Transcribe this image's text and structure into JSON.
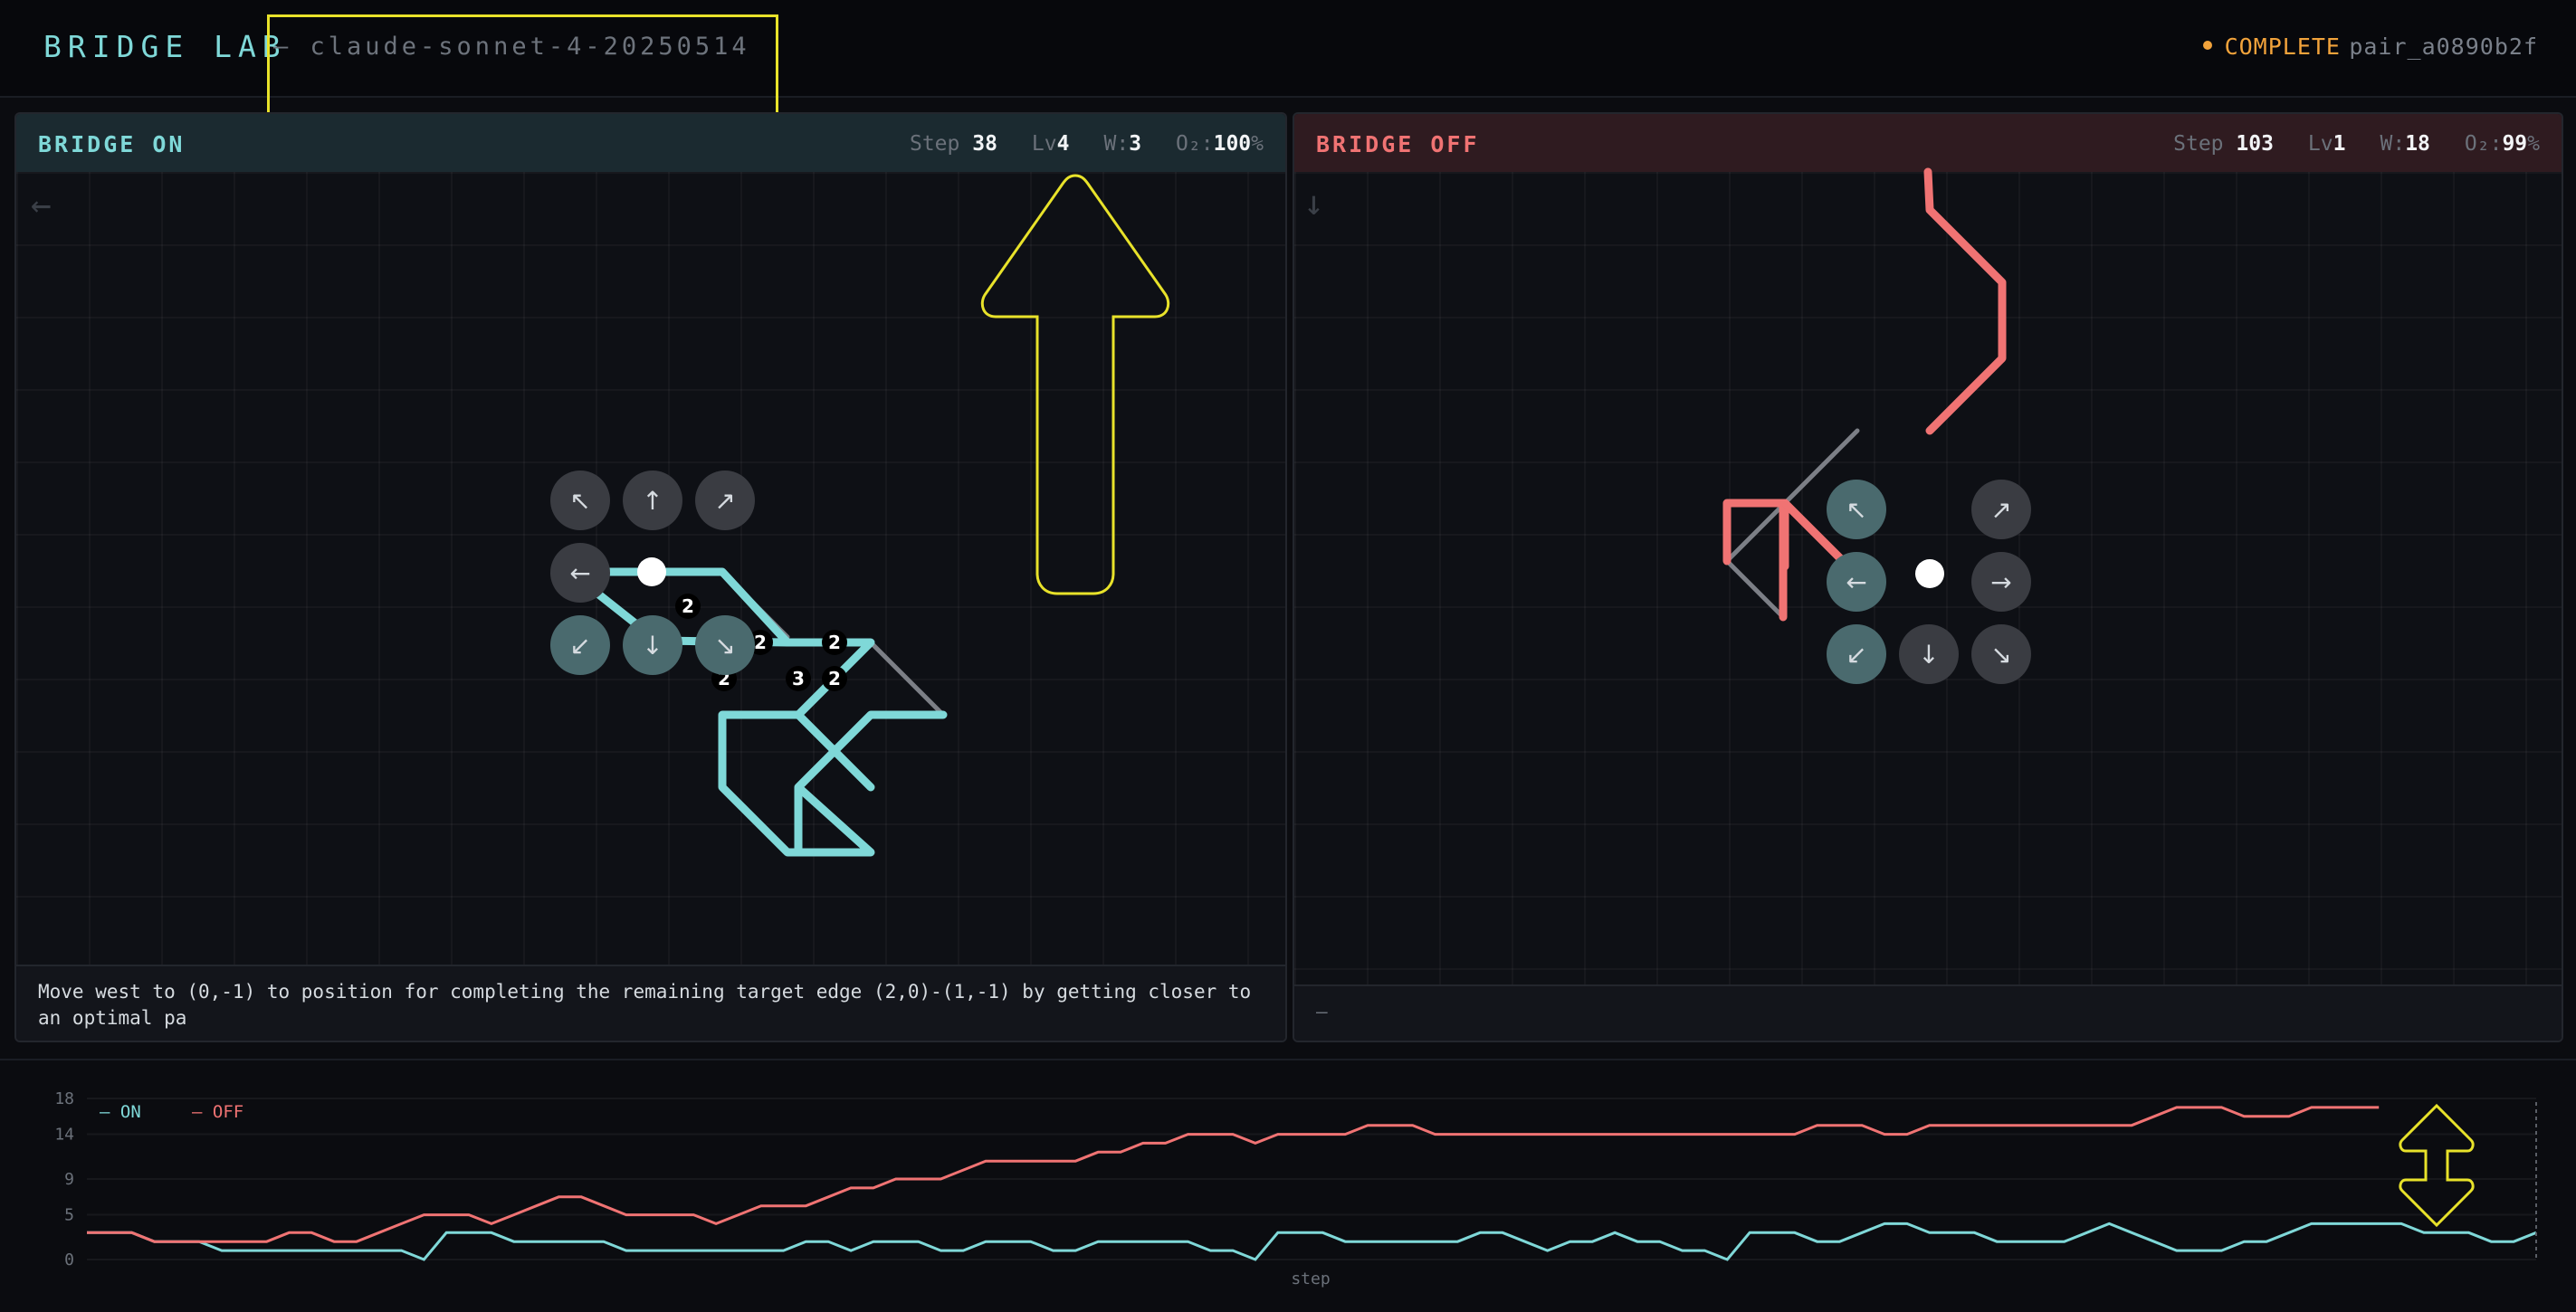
{
  "header": {
    "brand": "BRIDGE LAB",
    "model": "— claude-sonnet-4-20250514",
    "status": "COMPLETE",
    "pair_id": "pair_a0890b2f"
  },
  "panels": {
    "on": {
      "title": "BRIDGE ON",
      "step_label": "Step",
      "step": "38",
      "lv_label": "Lv",
      "lv": "4",
      "w_label": "W:",
      "w": "3",
      "o2_label": "O₂:",
      "o2": "100",
      "o2_unit": "%",
      "prev_move_icon": "←",
      "moves": [
        "↖",
        "↑",
        "↗",
        "←",
        "↙",
        "↓",
        "↘"
      ],
      "edge_labels": [
        "2",
        "2",
        "2",
        "2",
        "3",
        "2"
      ],
      "caption": "Move west to (0,-1) to position for completing the remaining target edge (2,0)-(1,-1) by getting closer to an optimal pa"
    },
    "off": {
      "title": "BRIDGE OFF",
      "step_label": "Step",
      "step": "103",
      "lv_label": "Lv",
      "lv": "1",
      "w_label": "W:",
      "w": "18",
      "o2_label": "O₂:",
      "o2": "99",
      "o2_unit": "%",
      "prev_move_icon": "↓",
      "moves": [
        "↖",
        "↗",
        "←",
        "→",
        "↙",
        "↓",
        "↘"
      ],
      "caption": "—"
    }
  },
  "colors": {
    "on": "#7fd8d8",
    "off": "#f07373",
    "status": "#f2a33b",
    "highlight": "#e8e22a"
  },
  "chart_data": {
    "type": "line",
    "xlabel": "step",
    "ylabel": "",
    "y_ticks": [
      0,
      5,
      9,
      14,
      18
    ],
    "ylim": [
      0,
      18
    ],
    "legend_position": "top-left",
    "series": [
      {
        "name": "ON",
        "color": "#7fd8d8",
        "values": [
          3,
          3,
          3,
          2,
          2,
          2,
          1,
          1,
          1,
          1,
          1,
          1,
          1,
          1,
          1,
          0,
          3,
          3,
          3,
          2,
          2,
          2,
          2,
          2,
          1,
          1,
          1,
          1,
          1,
          1,
          1,
          1,
          2,
          2,
          1,
          2,
          2,
          2,
          1,
          1,
          2,
          2,
          2,
          1,
          1,
          2,
          2,
          2,
          2,
          2,
          1,
          1,
          0,
          3,
          3,
          3,
          2,
          2,
          2,
          2,
          2,
          2,
          3,
          3,
          2,
          1,
          2,
          2,
          3,
          2,
          2,
          1,
          1,
          0,
          3,
          3,
          3,
          2,
          2,
          3,
          4,
          4,
          3,
          3,
          3,
          2,
          2,
          2,
          2,
          3,
          4,
          3,
          2,
          1,
          1,
          1,
          2,
          2,
          3,
          4,
          4,
          4,
          4,
          4,
          3,
          3,
          3,
          2,
          2,
          3
        ]
      },
      {
        "name": "OFF",
        "color": "#f07373",
        "values": [
          3,
          3,
          3,
          2,
          2,
          2,
          2,
          2,
          2,
          3,
          3,
          2,
          2,
          3,
          4,
          5,
          5,
          5,
          4,
          5,
          6,
          7,
          7,
          6,
          5,
          5,
          5,
          5,
          4,
          5,
          6,
          6,
          6,
          7,
          8,
          8,
          9,
          9,
          9,
          10,
          11,
          11,
          11,
          11,
          11,
          12,
          12,
          13,
          13,
          14,
          14,
          14,
          13,
          14,
          14,
          14,
          14,
          15,
          15,
          15,
          14,
          14,
          14,
          14,
          14,
          14,
          14,
          14,
          14,
          14,
          14,
          14,
          14,
          14,
          14,
          14,
          14,
          15,
          15,
          15,
          14,
          14,
          15,
          15,
          15,
          15,
          15,
          15,
          15,
          15,
          15,
          15,
          16,
          17,
          17,
          17,
          16,
          16,
          16,
          17,
          17,
          17,
          17
        ]
      }
    ]
  }
}
